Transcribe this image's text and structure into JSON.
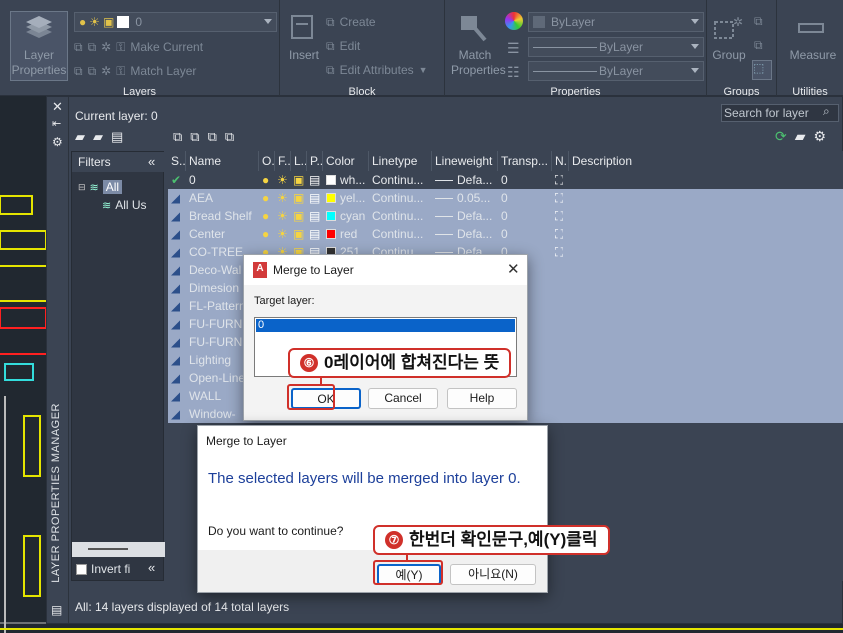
{
  "ribbon": {
    "layer_properties": "Layer\nProperties",
    "layer_dropdown_value": "0",
    "make_current": "Make Current",
    "match_layer": "Match Layer",
    "layers_title": "Layers",
    "insert": "Insert",
    "create": "Create",
    "edit": "Edit",
    "edit_attributes": "Edit Attributes",
    "block_title": "Block",
    "match_properties": "Match\nProperties",
    "bylayer_color": "ByLayer",
    "bylayer_lineweight": "ByLayer",
    "bylayer_linetype": "ByLayer",
    "properties_title": "Properties",
    "group": "Group",
    "groups_title": "Groups",
    "measure": "Measure",
    "utilities_title": "Utilities"
  },
  "palette": {
    "current_layer": "Current layer: 0",
    "search_placeholder": "Search for layer",
    "vertical_title": "LAYER PROPERTIES MANAGER",
    "filters_label": "Filters",
    "filter_all": "All",
    "filter_all_used": "All Us",
    "invert_filter": "Invert fi",
    "status": "All: 14 layers displayed of 14 total layers"
  },
  "grid": {
    "headers": [
      "S..",
      "Name",
      "O..",
      "F..",
      "L..",
      "P..",
      "Color",
      "Linetype",
      "Lineweight",
      "Transp...",
      "N..",
      "Description"
    ],
    "rows": [
      {
        "name": "0",
        "color_name": "wh...",
        "color": "#ffffff",
        "linetype": "Continu...",
        "lineweight": "Defa...",
        "transparency": "0",
        "current": true
      },
      {
        "name": "AEA",
        "color_name": "yel...",
        "color": "#ffff00",
        "linetype": "Continu...",
        "lineweight": "0.05...",
        "transparency": "0"
      },
      {
        "name": "Bread Shelf",
        "color_name": "cyan",
        "color": "#00ffff",
        "linetype": "Continu...",
        "lineweight": "Defa...",
        "transparency": "0"
      },
      {
        "name": "Center",
        "color_name": "red",
        "color": "#ff0000",
        "linetype": "Continu...",
        "lineweight": "Defa...",
        "transparency": "0"
      },
      {
        "name": "CO-TREE",
        "color_name": "251",
        "color": "#333333",
        "linetype": "Continu...",
        "lineweight": "Defa...",
        "transparency": "0"
      },
      {
        "name": "Deco-Wal"
      },
      {
        "name": "Dimesion"
      },
      {
        "name": "FL-Pattern"
      },
      {
        "name": "FU-FURN"
      },
      {
        "name": "FU-FURN"
      },
      {
        "name": "Lighting"
      },
      {
        "name": "Open-Line"
      },
      {
        "name": "WALL"
      },
      {
        "name": "Window-"
      }
    ]
  },
  "merge_dialog": {
    "title": "Merge to Layer",
    "target_label": "Target layer:",
    "selected_item": "0",
    "ok": "OK",
    "cancel": "Cancel",
    "help": "Help"
  },
  "confirm_dialog": {
    "title": "Merge to Layer",
    "message": "The selected layers will be merged into layer 0.",
    "question": "Do you want to continue?",
    "yes": "예(Y)",
    "no": "아니요(N)"
  },
  "callouts": {
    "step6_num": "⑥",
    "step6_text": "0레이어에 합쳐진다는 뜻",
    "step7_num": "⑦",
    "step7_text": "한번더 확인문구,예(Y)클릭"
  },
  "colors": {
    "accent_red": "#d0302a",
    "selection": "#9aa9c6",
    "list_selected": "#0a63c9"
  }
}
